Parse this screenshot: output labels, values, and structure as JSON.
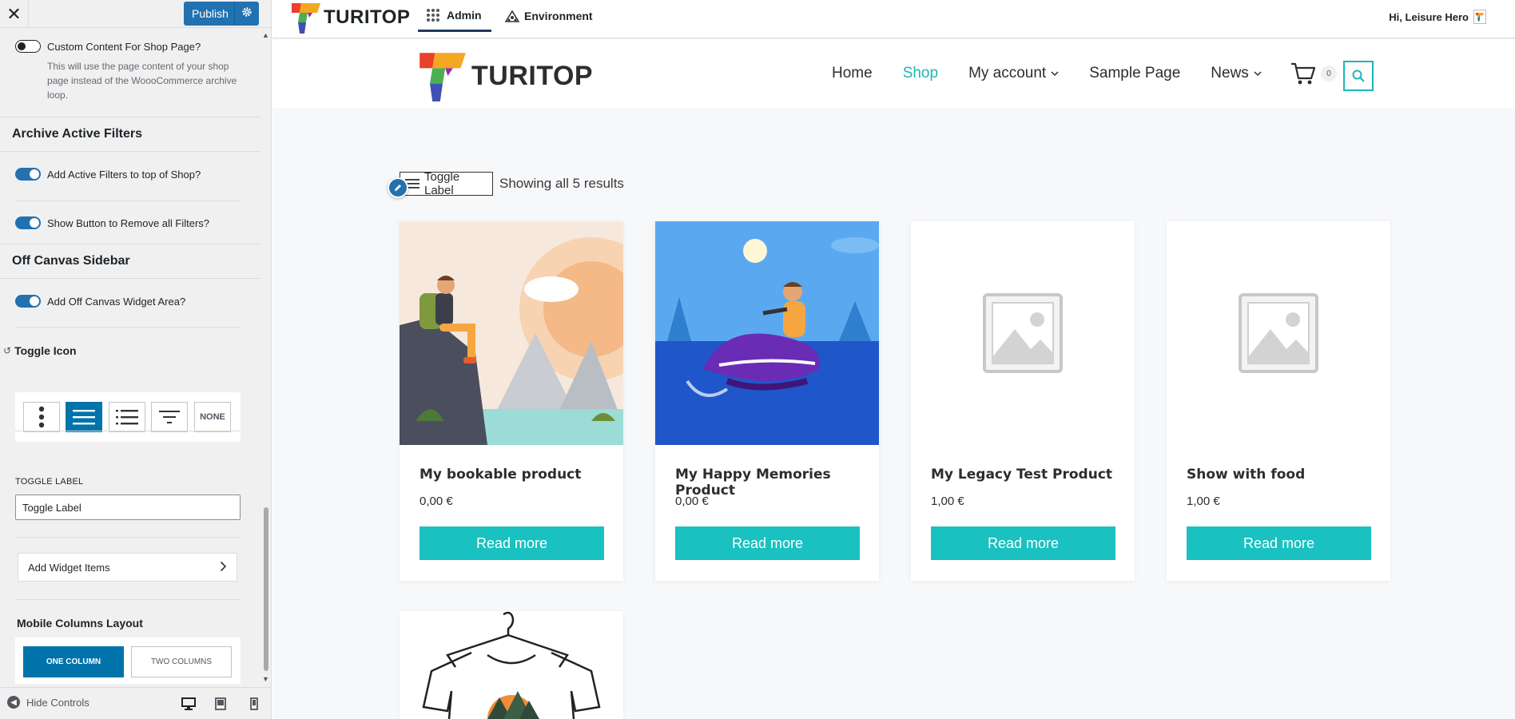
{
  "customizer": {
    "publish_label": "Publish",
    "shop_content": {
      "label": "Custom Content For Shop Page?",
      "description": "This will use the page content of your shop page instead of the WoooCommerce archive loop."
    },
    "archive_filters": {
      "heading": "Archive Active Filters",
      "add_filters_label": "Add Active Filters to top of Shop?",
      "remove_button_label": "Show Button to Remove all Filters?"
    },
    "off_canvas": {
      "heading": "Off Canvas Sidebar",
      "widget_area_label": "Add Off Canvas Widget Area?"
    },
    "toggle_icon": {
      "heading": "Toggle Icon",
      "options": [
        "vertical-dots",
        "hamburger",
        "list",
        "filter",
        "NONE"
      ],
      "selected": "hamburger"
    },
    "toggle_label": {
      "field_label": "TOGGLE LABEL",
      "value": "Toggle Label"
    },
    "add_widget_items_label": "Add Widget Items",
    "mobile_columns": {
      "heading": "Mobile Columns Layout",
      "one_column": "ONE COLUMN",
      "two_columns": "TWO COLUMNS",
      "selected": "ONE COLUMN"
    },
    "footer": {
      "hide_controls_label": "Hide Controls"
    }
  },
  "admin_bar": {
    "brand": "TURITOP",
    "admin_tab": "Admin",
    "environment_tab": "Environment",
    "greeting": "Hi, Leisure Hero"
  },
  "site": {
    "brand": "TURITOP",
    "nav": [
      "Home",
      "Shop",
      "My account",
      "Sample Page",
      "News"
    ],
    "active_nav": "Shop",
    "cart_count": "0"
  },
  "shop": {
    "toggle_label": "Toggle Label",
    "results_text": "Showing all 5 results",
    "products": [
      {
        "title": "My bookable product",
        "price": "0,00 €",
        "button": "Read more"
      },
      {
        "title": "My Happy Memories Product",
        "price": "0,00 €",
        "button": "Read more"
      },
      {
        "title": "My Legacy Test Product",
        "price": "1,00 €",
        "button": "Read more"
      },
      {
        "title": "Show with food",
        "price": "1,00 €",
        "button": "Read more"
      }
    ]
  },
  "colors": {
    "wp_blue": "#2271b1",
    "active_icon": "#0073aa",
    "brand_teal": "#19c1c1"
  }
}
